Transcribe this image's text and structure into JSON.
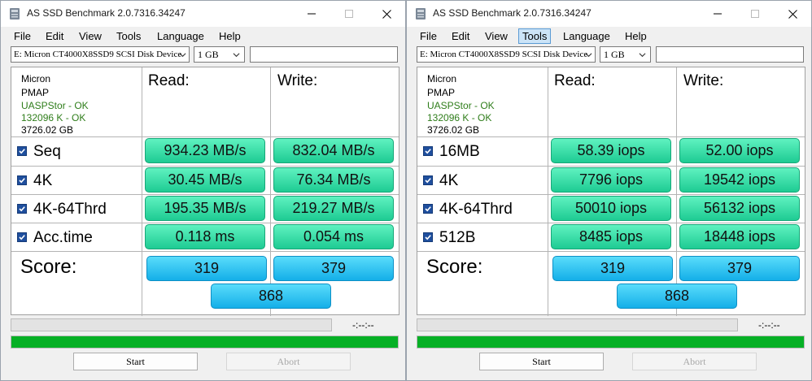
{
  "title": "AS SSD Benchmark 2.0.7316.34247",
  "menu": [
    "File",
    "Edit",
    "View",
    "Tools",
    "Language",
    "Help"
  ],
  "drive": "E: Micron CT4000X8SSD9 SCSI Disk Device",
  "size": "1 GB",
  "info": [
    "Micron",
    "PMAP",
    "UASPStor - OK",
    "132096 K - OK",
    "3726.02 GB"
  ],
  "read_header": "Read:",
  "write_header": "Write:",
  "score_label": "Score:",
  "start_label": "Start",
  "abort_label": "Abort",
  "timer": "-:--:--",
  "progress_fraction": 1.0,
  "windows": [
    {
      "active_menu": -1,
      "rows": [
        {
          "label": "Seq",
          "read": "934.23 MB/s",
          "write": "832.04 MB/s"
        },
        {
          "label": "4K",
          "read": "30.45 MB/s",
          "write": "76.34 MB/s"
        },
        {
          "label": "4K-64Thrd",
          "read": "195.35 MB/s",
          "write": "219.27 MB/s"
        },
        {
          "label": "Acc.time",
          "read": "0.118 ms",
          "write": "0.054 ms"
        }
      ],
      "score": {
        "read": "319",
        "write": "379",
        "total": "868"
      }
    },
    {
      "active_menu": 3,
      "rows": [
        {
          "label": "16MB",
          "read": "58.39 iops",
          "write": "52.00 iops"
        },
        {
          "label": "4K",
          "read": "7796 iops",
          "write": "19542 iops"
        },
        {
          "label": "4K-64Thrd",
          "read": "50010 iops",
          "write": "56132 iops"
        },
        {
          "label": "512B",
          "read": "8485 iops",
          "write": "18448 iops"
        }
      ],
      "score": {
        "read": "319",
        "write": "379",
        "total": "868"
      }
    }
  ],
  "colors": {
    "progress": "#06b025",
    "result_green": "#2ee0a6",
    "score_blue": "#22bff2",
    "ok_text": "#2e7d1a"
  }
}
